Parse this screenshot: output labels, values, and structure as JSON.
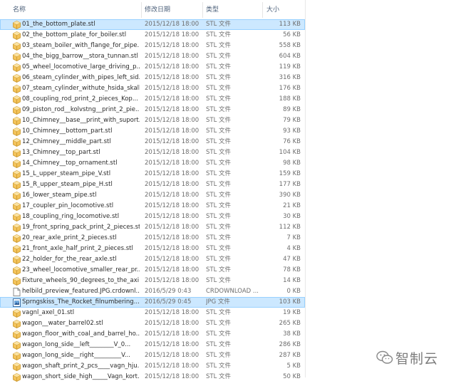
{
  "columns": {
    "name": "名称",
    "date": "修改日期",
    "type": "类型",
    "size": "大小"
  },
  "rows": [
    {
      "name": "01_the_bottom_plate.stl",
      "date": "2015/12/18 18:00",
      "type": "STL 文件",
      "size": "113 KB",
      "icon": "stl-file-icon",
      "selected": true
    },
    {
      "name": "02_the_bottom_plate_for_boiler.stl",
      "date": "2015/12/18 18:00",
      "type": "STL 文件",
      "size": "56 KB",
      "icon": "stl-file-icon"
    },
    {
      "name": "03_steam_boiler_with_flange_for_pipe...",
      "date": "2015/12/18 18:00",
      "type": "STL 文件",
      "size": "558 KB",
      "icon": "stl-file-icon"
    },
    {
      "name": "04_the_bigg_barrow__stora_tunnan.stl",
      "date": "2015/12/18 18:00",
      "type": "STL 文件",
      "size": "604 KB",
      "icon": "stl-file-icon"
    },
    {
      "name": "05_wheel_locomotive_large_driving_p...",
      "date": "2015/12/18 18:00",
      "type": "STL 文件",
      "size": "119 KB",
      "icon": "stl-file-icon"
    },
    {
      "name": "06_steam_cylinder_with_pipes_left_sid...",
      "date": "2015/12/18 18:00",
      "type": "STL 文件",
      "size": "316 KB",
      "icon": "stl-file-icon"
    },
    {
      "name": "07_steam_cylinder_withute_hsida_skall...",
      "date": "2015/12/18 18:00",
      "type": "STL 文件",
      "size": "176 KB",
      "icon": "stl-file-icon"
    },
    {
      "name": "08_coupling_rod_print_2_pieces_Kop...",
      "date": "2015/12/18 18:00",
      "type": "STL 文件",
      "size": "188 KB",
      "icon": "stl-file-icon"
    },
    {
      "name": "09_piston_rod__kolvstng__print_2_pie...",
      "date": "2015/12/18 18:00",
      "type": "STL 文件",
      "size": "89 KB",
      "icon": "stl-file-icon"
    },
    {
      "name": "10_Chimney__base__print_with_suport...",
      "date": "2015/12/18 18:00",
      "type": "STL 文件",
      "size": "79 KB",
      "icon": "stl-file-icon"
    },
    {
      "name": "10_Chimney__bottom_part.stl",
      "date": "2015/12/18 18:00",
      "type": "STL 文件",
      "size": "93 KB",
      "icon": "stl-file-icon"
    },
    {
      "name": "12_Chimney__middle_part.stl",
      "date": "2015/12/18 18:00",
      "type": "STL 文件",
      "size": "76 KB",
      "icon": "stl-file-icon"
    },
    {
      "name": "13_Chimney__top_part.stl",
      "date": "2015/12/18 18:00",
      "type": "STL 文件",
      "size": "104 KB",
      "icon": "stl-file-icon"
    },
    {
      "name": "14_Chimney__top_ornament.stl",
      "date": "2015/12/18 18:00",
      "type": "STL 文件",
      "size": "98 KB",
      "icon": "stl-file-icon"
    },
    {
      "name": "15_L_upper_steam_pipe_V.stl",
      "date": "2015/12/18 18:00",
      "type": "STL 文件",
      "size": "159 KB",
      "icon": "stl-file-icon"
    },
    {
      "name": "15_R_upper_steam_pipe_H.stl",
      "date": "2015/12/18 18:00",
      "type": "STL 文件",
      "size": "177 KB",
      "icon": "stl-file-icon"
    },
    {
      "name": "16_lower_steam_pipe.stl",
      "date": "2015/12/18 18:00",
      "type": "STL 文件",
      "size": "390 KB",
      "icon": "stl-file-icon"
    },
    {
      "name": "17_coupler_pin_locomotive.stl",
      "date": "2015/12/18 18:00",
      "type": "STL 文件",
      "size": "21 KB",
      "icon": "stl-file-icon"
    },
    {
      "name": "18_coupling_ring_locomotive.stl",
      "date": "2015/12/18 18:00",
      "type": "STL 文件",
      "size": "30 KB",
      "icon": "stl-file-icon"
    },
    {
      "name": "19_front_spring_pack_print_2_pieces.stl",
      "date": "2015/12/18 18:00",
      "type": "STL 文件",
      "size": "112 KB",
      "icon": "stl-file-icon"
    },
    {
      "name": "20_rear_axle_print_2_pieces.stl",
      "date": "2015/12/18 18:00",
      "type": "STL 文件",
      "size": "7 KB",
      "icon": "stl-file-icon"
    },
    {
      "name": "21_front_axle_half_print_2_pieces.stl",
      "date": "2015/12/18 18:00",
      "type": "STL 文件",
      "size": "4 KB",
      "icon": "stl-file-icon"
    },
    {
      "name": "22_holder_for_the_rear_axle.stl",
      "date": "2015/12/18 18:00",
      "type": "STL 文件",
      "size": "47 KB",
      "icon": "stl-file-icon"
    },
    {
      "name": "23_wheel_locomotive_smaller_rear_pr...",
      "date": "2015/12/18 18:00",
      "type": "STL 文件",
      "size": "78 KB",
      "icon": "stl-file-icon"
    },
    {
      "name": "Fixture_wheels_90_degrees_to_the_axi...",
      "date": "2015/12/18 18:00",
      "type": "STL 文件",
      "size": "14 KB",
      "icon": "stl-file-icon"
    },
    {
      "name": "helbild_preview_featured.JPG.crdownl...",
      "date": "2016/5/29 0:43",
      "type": "CRDOWNLOAD ...",
      "size": "0 KB",
      "icon": "blank-file-icon"
    },
    {
      "name": "Sprngskiss_The_Rocket_filnumbering...",
      "date": "2016/5/29 0:45",
      "type": "JPG 文件",
      "size": "103 KB",
      "icon": "jpg-file-icon",
      "selected": true
    },
    {
      "name": "vagnl_axel_01.stl",
      "date": "2015/12/18 18:00",
      "type": "STL 文件",
      "size": "19 KB",
      "icon": "stl-file-icon"
    },
    {
      "name": "wagon__water_barrel02.stl",
      "date": "2015/12/18 18:00",
      "type": "STL 文件",
      "size": "265 KB",
      "icon": "stl-file-icon"
    },
    {
      "name": "wagon_floor_with_coal_and_barrel_ho...",
      "date": "2015/12/18 18:00",
      "type": "STL 文件",
      "size": "38 KB",
      "icon": "stl-file-icon"
    },
    {
      "name": "wagon_long_side__left________V_0...",
      "date": "2015/12/18 18:00",
      "type": "STL 文件",
      "size": "286 KB",
      "icon": "stl-file-icon"
    },
    {
      "name": "wagon_long_side__right_________V...",
      "date": "2015/12/18 18:00",
      "type": "STL 文件",
      "size": "287 KB",
      "icon": "stl-file-icon"
    },
    {
      "name": "wagon_shaft_print_2_pcs____vagn_hju...",
      "date": "2015/12/18 18:00",
      "type": "STL 文件",
      "size": "5 KB",
      "icon": "stl-file-icon"
    },
    {
      "name": "wagon_short_side_high_____Vagn_kort...",
      "date": "2015/12/18 18:00",
      "type": "STL 文件",
      "size": "50 KB",
      "icon": "stl-file-icon"
    }
  ],
  "watermark": {
    "text": "智制云",
    "icon": "wechat-logo-icon"
  }
}
